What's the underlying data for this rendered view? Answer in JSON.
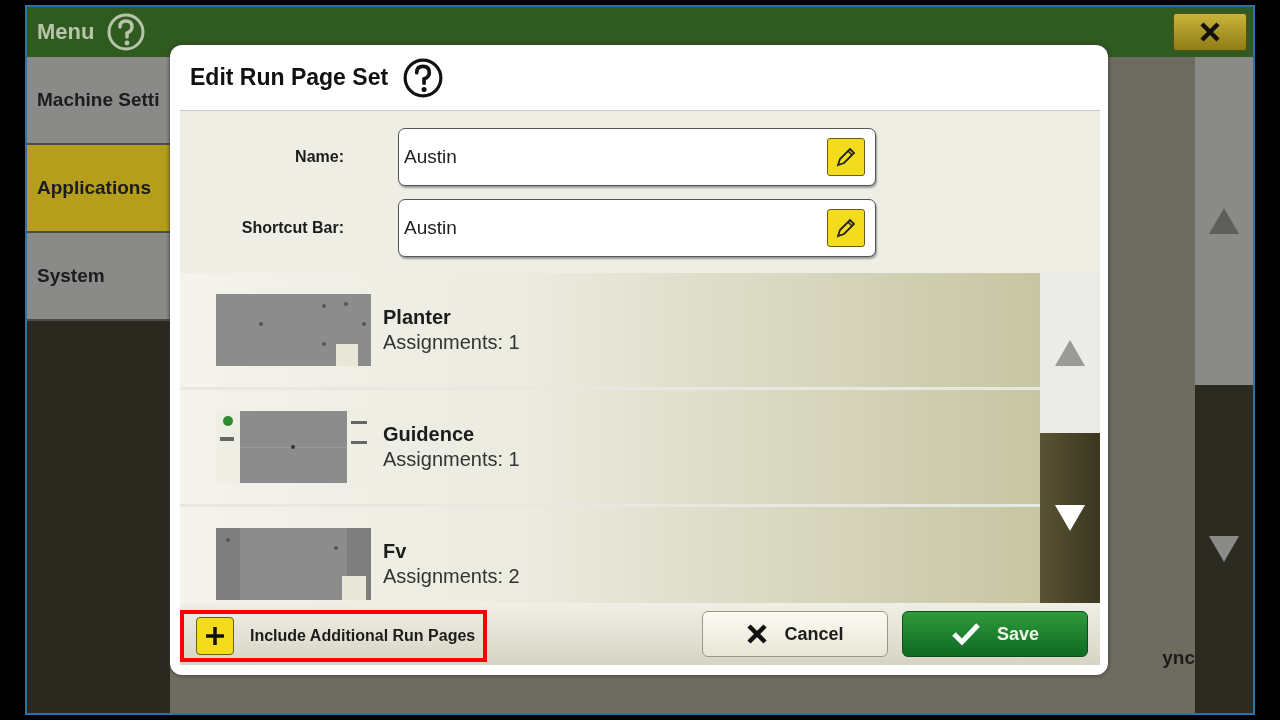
{
  "menu": {
    "title": "Menu",
    "items": [
      {
        "label": "Machine Setti",
        "selected": false
      },
      {
        "label": "Applications",
        "selected": true
      },
      {
        "label": "System",
        "selected": false
      }
    ]
  },
  "background": {
    "fragment": "ync"
  },
  "dialog": {
    "title": "Edit Run Page Set",
    "fields": [
      {
        "label": "Name:",
        "value": "Austin"
      },
      {
        "label": "Shortcut Bar:",
        "value": "Austin"
      }
    ],
    "run_pages": [
      {
        "name": "Planter",
        "assignments": "Assignments: 1",
        "kind": "overlay"
      },
      {
        "name": "Guidence",
        "assignments": "Assignments: 1",
        "kind": "sidebars"
      },
      {
        "name": "Fv",
        "assignments": "Assignments: 2",
        "kind": "columns"
      }
    ],
    "include_button": {
      "label": "Include Additional Run Pages",
      "highlighted": true
    },
    "buttons": [
      {
        "kind": "cancel",
        "label": "Cancel"
      },
      {
        "kind": "save",
        "label": "Save"
      }
    ]
  }
}
